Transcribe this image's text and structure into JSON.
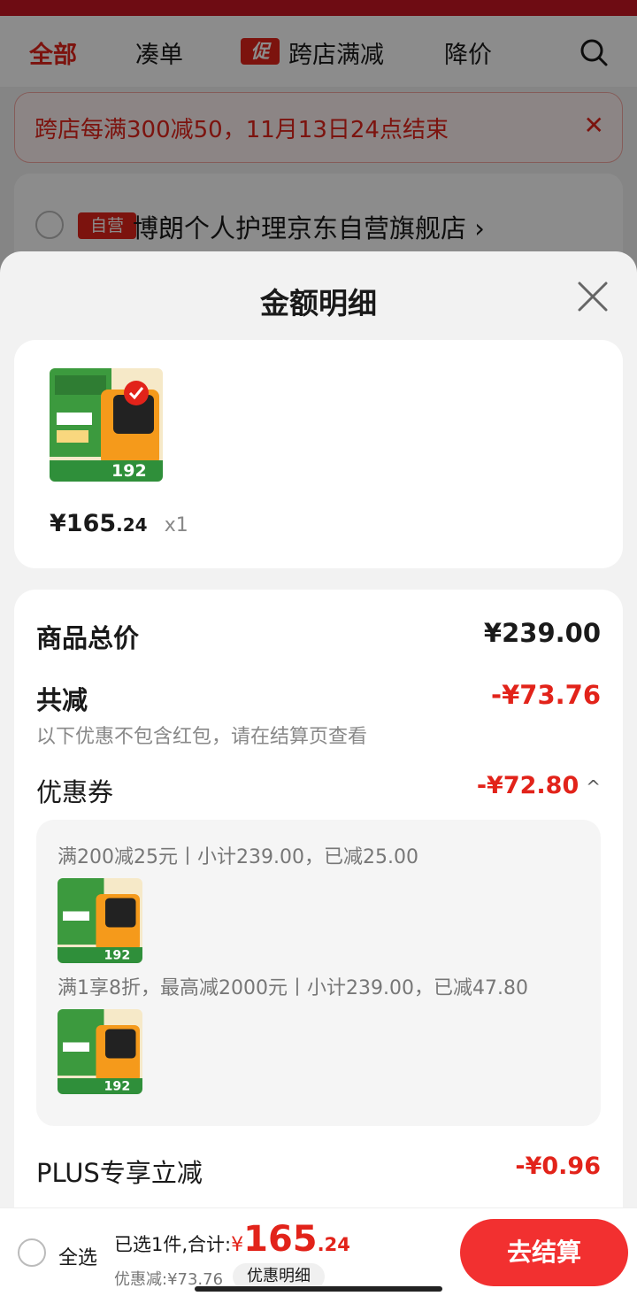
{
  "tabs": [
    {
      "label": "全部",
      "active": true
    },
    {
      "label": "凑单"
    },
    {
      "label": "跨店满减",
      "badge": "促"
    },
    {
      "label": "降价"
    }
  ],
  "promo_banner": {
    "text": "跨店每满300减50，11月13日24点结束",
    "close": "✕"
  },
  "store": {
    "badge": "自营",
    "name": "博朗个人护理京东自营旗舰店",
    "chevron": "›"
  },
  "sheet": {
    "title": "金额明细"
  },
  "product": {
    "price_main": "165",
    "price_decimal": ".24",
    "price_prefix": "¥",
    "qty": "x1",
    "image_text": "192"
  },
  "detail": {
    "total_label": "商品总价",
    "total_value": "¥239.00",
    "discount_label": "共减",
    "discount_value": "-¥73.76",
    "discount_note": "以下优惠不包含红包，请在结算页查看",
    "coupon_label": "优惠券",
    "coupon_value": "-¥72.80",
    "coupon_caret": "^",
    "coupon_rules": [
      {
        "text": "满200减25元丨小计239.00，已减25.00"
      },
      {
        "text": "满1享8折，最高减2000元丨小计239.00，已减47.80"
      }
    ],
    "plus_label": "PLUS专享立减",
    "plus_value": "-¥0.96"
  },
  "bottom": {
    "select_all": "全选",
    "summary_prefix": "已选1件,合计:",
    "yen": "¥",
    "amount_main": "165",
    "amount_decimal": ".24",
    "saving": "优惠减:¥73.76",
    "detail_button": "优惠明细",
    "checkout_button": "去结算"
  },
  "colors": {
    "accent_red": "#e2231a",
    "checkout_red": "#f23030"
  }
}
